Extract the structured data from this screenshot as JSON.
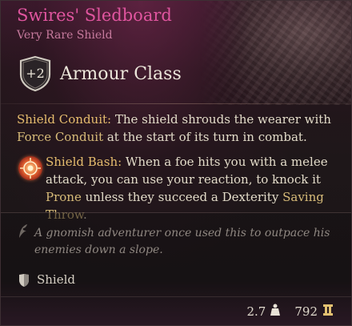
{
  "item": {
    "name": "Swires' Sledboard",
    "rarity": "Very Rare Shield",
    "armour": {
      "value": "+2",
      "label": "Armour Class"
    },
    "passive": {
      "title": "Shield Conduit:",
      "text_before": " The shield shrouds the wearer with ",
      "link": "Force Conduit",
      "text_after": " at the start of its turn in combat."
    },
    "bash": {
      "title": "Shield Bash:",
      "text_1": " When a foe hits you with a melee attack, you can use your reaction, to knock it ",
      "link_1": "Prone",
      "text_2": " unless they succeed a Dexterity ",
      "link_2": "Saving Throw",
      "text_3": "."
    },
    "flavor": "A gnomish adventurer once used this to outpace his enemies down a slope.",
    "type": "Shield",
    "weight": "2.7",
    "value": "792"
  },
  "colors": {
    "name": "#e0559f",
    "rarity": "#c67a9d",
    "highlight": "#e6bd6e"
  },
  "icons": {
    "armour": "shield-outline-icon",
    "bash": "shield-bash-icon",
    "flavor": "quill-icon",
    "type": "shield-icon",
    "weight": "weight-icon",
    "gold": "gold-coin-icon"
  }
}
